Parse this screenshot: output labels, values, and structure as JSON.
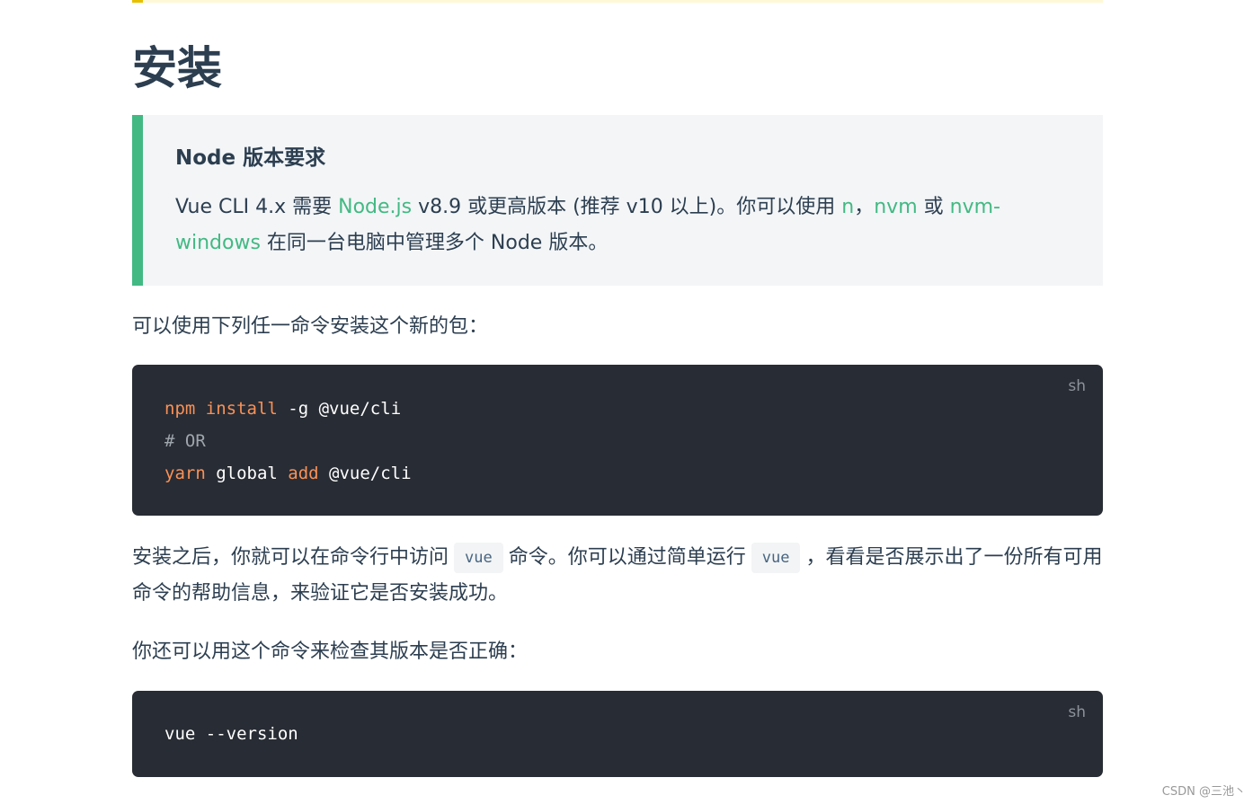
{
  "heading": "安装",
  "tip": {
    "title": "Node 版本要求",
    "body": {
      "t1": "Vue CLI 4.x 需要 ",
      "link_node": "Node.js",
      "t2": " v8.9 或更高版本 (推荐 v10 以上)。你可以使用 ",
      "link_n": "n",
      "t3": "，",
      "link_nvm": "nvm",
      "t4": " 或 ",
      "link_nvm_windows": "nvm-windows",
      "t5": " 在同一台电脑中管理多个 Node 版本。"
    },
    "accent_color": "#42b983"
  },
  "paragraphs": {
    "install_intro": "可以使用下列任一命令安装这个新的包：",
    "after_install": {
      "t1": "安装之后，你就可以在命令行中访问",
      "code1": "vue",
      "t2": "命令。你可以通过简单运行",
      "code2": "vue",
      "t3": "，看看是否展示出了一份所有可用命令的帮助信息，来验证它是否安装成功。"
    },
    "version_intro": "你还可以用这个命令来检查其版本是否正确："
  },
  "code_blocks": {
    "install": {
      "lang": "sh",
      "line1": {
        "t1": "npm",
        "t2": " ",
        "t3": "install",
        "t4": " -g @vue/cli"
      },
      "line2": "# OR",
      "line3": {
        "t1": "yarn",
        "t2": " global ",
        "t3": "add",
        "t4": " @vue/cli"
      }
    },
    "version": {
      "lang": "sh",
      "line1": "vue --version"
    }
  },
  "watermark": "CSDN @三池丶",
  "colors": {
    "code_bg": "#282c34",
    "keyword": "#f99157",
    "link": "#42b983",
    "text": "#2c3e50"
  }
}
